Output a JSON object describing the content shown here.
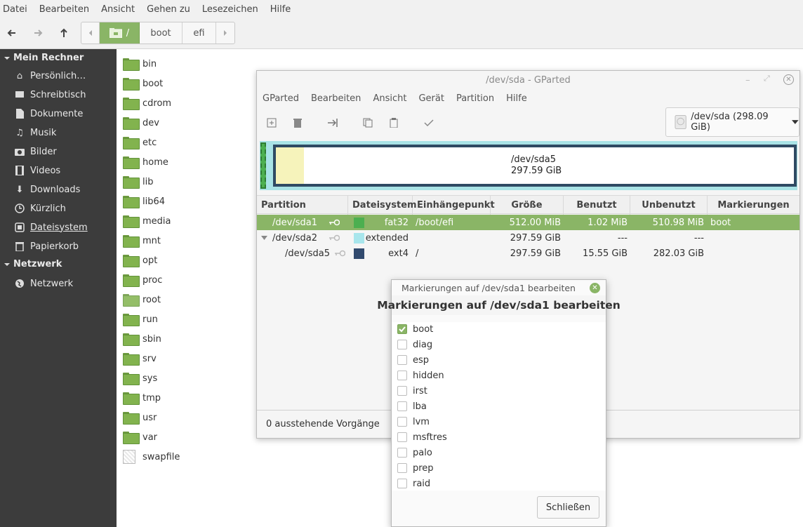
{
  "nemo": {
    "menu": [
      "Datei",
      "Bearbeiten",
      "Ansicht",
      "Gehen zu",
      "Lesezeichen",
      "Hilfe"
    ],
    "breadcrumbs": [
      "/",
      "boot",
      "efi"
    ],
    "sidebar": {
      "sections": [
        {
          "title": "Mein Rechner",
          "items": [
            {
              "label": "Persönlich…",
              "icon": "home-icon"
            },
            {
              "label": "Schreibtisch",
              "icon": "desktop-icon"
            },
            {
              "label": "Dokumente",
              "icon": "document-icon"
            },
            {
              "label": "Musik",
              "icon": "music-icon"
            },
            {
              "label": "Bilder",
              "icon": "camera-icon"
            },
            {
              "label": "Videos",
              "icon": "film-icon"
            },
            {
              "label": "Downloads",
              "icon": "download-icon"
            },
            {
              "label": "Kürzlich",
              "icon": "clock-icon"
            },
            {
              "label": "Dateisystem",
              "icon": "drive-icon"
            },
            {
              "label": "Papierkorb",
              "icon": "trash-icon"
            }
          ]
        },
        {
          "title": "Netzwerk",
          "items": [
            {
              "label": "Netzwerk",
              "icon": "globe-icon"
            }
          ]
        }
      ]
    },
    "files": [
      "bin",
      "boot",
      "cdrom",
      "dev",
      "etc",
      "home",
      "lib",
      "lib64",
      "media",
      "mnt",
      "opt",
      "proc",
      "root",
      "run",
      "sbin",
      "srv",
      "sys",
      "tmp",
      "usr",
      "var",
      "swapfile"
    ]
  },
  "gparted": {
    "title": "/dev/sda - GParted",
    "menu": [
      "GParted",
      "Bearbeiten",
      "Ansicht",
      "Gerät",
      "Partition",
      "Hilfe"
    ],
    "device": "/dev/sda (298.09 GiB)",
    "disk_label": {
      "name": "/dev/sda5",
      "size": "297.59 GiB"
    },
    "columns": [
      "Partition",
      "Dateisystem",
      "Einhängepunkt",
      "Größe",
      "Benutzt",
      "Unbenutzt",
      "Markierungen"
    ],
    "rows": [
      {
        "partition": "/dev/sda1",
        "fs": "fat32",
        "color": "#4caf50",
        "mount": "/boot/efi",
        "size": "512.00 MiB",
        "used": "1.02 MiB",
        "unused": "510.98 MiB",
        "flags": "boot"
      },
      {
        "partition": "/dev/sda2",
        "fs": "extended",
        "color": "#a8e6ec",
        "mount": "",
        "size": "297.59 GiB",
        "used": "---",
        "unused": "---",
        "flags": ""
      },
      {
        "partition": "/dev/sda5",
        "fs": "ext4",
        "color": "#314a6e",
        "mount": "/",
        "size": "297.59 GiB",
        "used": "15.55 GiB",
        "unused": "282.03 GiB",
        "flags": ""
      }
    ],
    "status": "0 ausstehende Vorgänge"
  },
  "dialog": {
    "window_title": "Markierungen auf /dev/sda1 bearbeiten",
    "heading": "Markierungen auf /dev/sda1 bearbeiten",
    "flags": [
      {
        "label": "boot",
        "checked": true
      },
      {
        "label": "diag",
        "checked": false
      },
      {
        "label": "esp",
        "checked": false
      },
      {
        "label": "hidden",
        "checked": false
      },
      {
        "label": "irst",
        "checked": false
      },
      {
        "label": "lba",
        "checked": false
      },
      {
        "label": "lvm",
        "checked": false
      },
      {
        "label": "msftres",
        "checked": false
      },
      {
        "label": "palo",
        "checked": false
      },
      {
        "label": "prep",
        "checked": false
      },
      {
        "label": "raid",
        "checked": false
      }
    ],
    "close_label": "Schließen"
  },
  "colors": {
    "accent": "#8ab566",
    "sidebar_bg": "#3c3c3c",
    "selected_row": "#8ab566"
  }
}
